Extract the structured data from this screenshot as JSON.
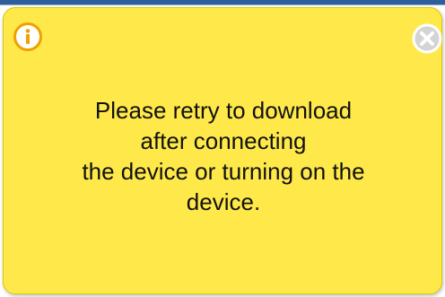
{
  "dialog": {
    "message_lines": [
      "Please retry to download",
      "after connecting",
      "the device or turning on the",
      "device."
    ],
    "info_icon": "info-icon",
    "close_icon": "close-icon",
    "colors": {
      "background": "#ffe94a",
      "info_icon": "#f4a300",
      "close_icon": "#cfcfcf"
    }
  }
}
